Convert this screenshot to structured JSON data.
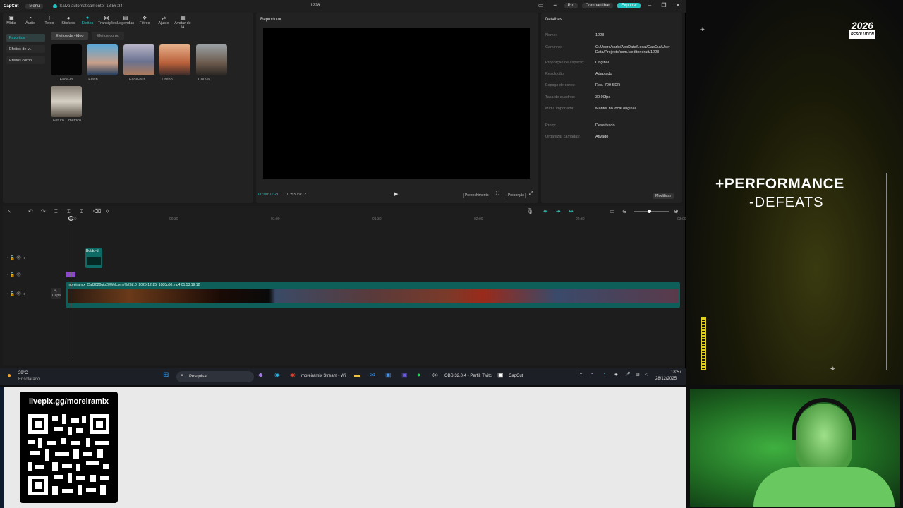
{
  "app": {
    "logo": "CapCut",
    "menu": "Menu",
    "saved": "Salvo automaticamente: 18:56:34",
    "project": "1228",
    "pro": "Pro",
    "share": "Compartilhar",
    "export": "Exportar"
  },
  "toolbar": [
    {
      "label": "Mídia",
      "icon": "media-icon"
    },
    {
      "label": "Áudio",
      "icon": "audio-icon"
    },
    {
      "label": "Texto",
      "icon": "text-icon"
    },
    {
      "label": "Stickers",
      "icon": "sticker-icon"
    },
    {
      "label": "Efeitos",
      "icon": "effects-icon",
      "active": true
    },
    {
      "label": "Transições",
      "icon": "transition-icon"
    },
    {
      "label": "Legendas",
      "icon": "captions-icon"
    },
    {
      "label": "Filtros",
      "icon": "filter-icon"
    },
    {
      "label": "Ajuste",
      "icon": "adjust-icon"
    },
    {
      "label": "Avatar de IA",
      "icon": "avatar-icon"
    }
  ],
  "effects": {
    "side": [
      "Favoritos",
      "Efeitos de v...",
      "Efeitos corpo"
    ],
    "tabs": [
      "Efeitos de vídeo",
      "Efeitos corpo"
    ],
    "items": [
      "Fade-in",
      "Flash",
      "Fade-out",
      "Divino",
      "Chuva",
      "Futuro ...métrico"
    ]
  },
  "player": {
    "title": "Reprodutor",
    "current": "00:00:01:21",
    "total": "01:53:19:12",
    "btn1": "Preenchimento",
    "btn2": "Proporção"
  },
  "details": {
    "title": "Detalhes",
    "rows": [
      {
        "k": "Nome:",
        "v": "1228"
      },
      {
        "k": "Caminho:",
        "v": "C:/Users/carlo/AppData/Local/CapCut/User Data/Projects/com.lveditor.draft/1228"
      },
      {
        "k": "Proporção de aspecto:",
        "v": "Original"
      },
      {
        "k": "Resolução:",
        "v": "Adaptado"
      },
      {
        "k": "Espaço de cores:",
        "v": "Rec. 709 SDR"
      },
      {
        "k": "Taxa de quadros:",
        "v": "30.00fps"
      },
      {
        "k": "Mídia importada:",
        "v": "Manter no local original"
      },
      {
        "k": "Proxy:",
        "v": "Desativado"
      },
      {
        "k": "Organizar camadas:",
        "v": "Ativado"
      }
    ],
    "modify": "Modificar"
  },
  "timeline": {
    "ruler": [
      "00:00",
      "00:30",
      "01:00",
      "01:30",
      "02:00",
      "02:30",
      "03:00"
    ],
    "clip1": "Botão-d",
    "cover": "Capa",
    "main_clip": "moreiramix_Call2020uto20Welcome%20Z.0_2025-12-25_1080p60.mp4   01:53:19:12"
  },
  "overlay": {
    "resolution_top": "2026",
    "resolution_bottom": "RESOLUTION",
    "perf1": "+PERFORMANCE",
    "perf2": "-DEFEATS"
  },
  "taskbar": {
    "temp": "29°C",
    "weather": "Ensolarado",
    "search": "Pesquisar",
    "app1": "moreiramix Stream - Wi",
    "app2": "OBS 32.0.4 - Perfil: Twitc",
    "app3": "CapCut",
    "time": "18:57",
    "date": "28/12/2025"
  },
  "qr": {
    "title": "livepix.gg/moreiramix"
  }
}
